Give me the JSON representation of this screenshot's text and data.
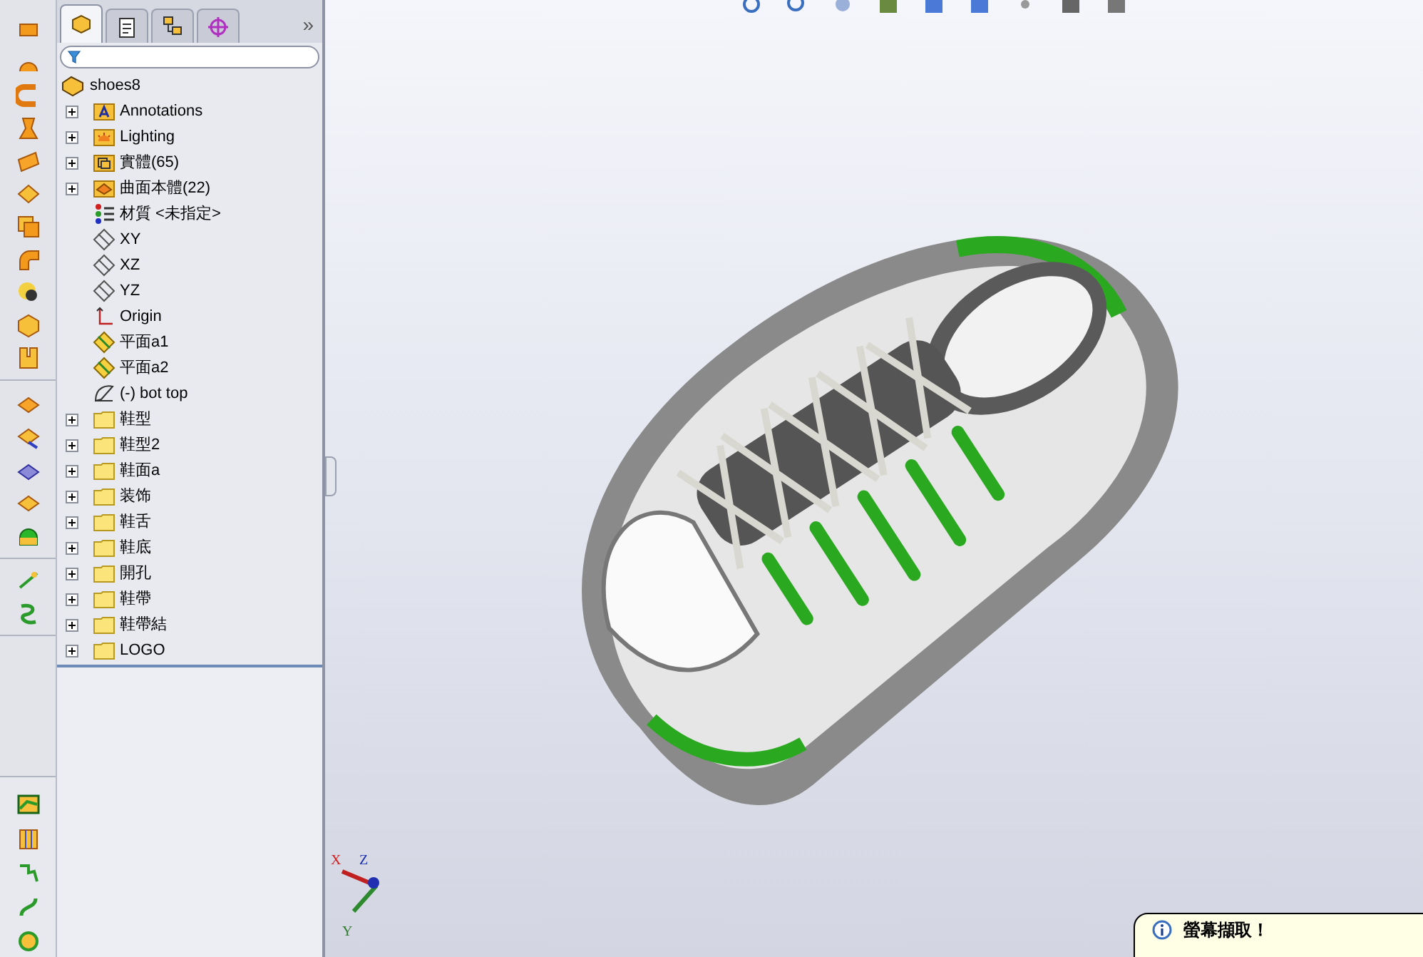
{
  "feature_tabs": [
    {
      "kind": "features",
      "selected": true
    },
    {
      "kind": "properties",
      "selected": false
    },
    {
      "kind": "configurations",
      "selected": false
    },
    {
      "kind": "dimxpert",
      "selected": false
    }
  ],
  "more_tabs": "»",
  "tree": {
    "root": {
      "label": "shoes8"
    },
    "items": [
      {
        "label": "Annotations",
        "kind": "annotations",
        "expanded": false
      },
      {
        "label": "Lighting",
        "kind": "lighting",
        "expanded": false
      },
      {
        "label": "實體(65)",
        "kind": "solids",
        "expanded": false
      },
      {
        "label": "曲面本體(22)",
        "kind": "surfaces",
        "expanded": false
      },
      {
        "label": "材質 <未指定>",
        "kind": "material"
      },
      {
        "label": "XY",
        "kind": "plane"
      },
      {
        "label": "XZ",
        "kind": "plane"
      },
      {
        "label": "YZ",
        "kind": "plane"
      },
      {
        "label": "Origin",
        "kind": "origin"
      },
      {
        "label": "平面a1",
        "kind": "refplane"
      },
      {
        "label": "平面a2",
        "kind": "refplane"
      },
      {
        "label": "(-) bot top",
        "kind": "sketch"
      },
      {
        "label": "鞋型",
        "kind": "folder",
        "expanded": false
      },
      {
        "label": "鞋型2",
        "kind": "folder",
        "expanded": false
      },
      {
        "label": "鞋面a",
        "kind": "folder",
        "expanded": false
      },
      {
        "label": "装饰",
        "kind": "folder",
        "expanded": false
      },
      {
        "label": "鞋舌",
        "kind": "folder",
        "expanded": false
      },
      {
        "label": "鞋底",
        "kind": "folder",
        "expanded": false
      },
      {
        "label": "開孔",
        "kind": "folder",
        "expanded": false
      },
      {
        "label": "鞋帶",
        "kind": "folder",
        "expanded": false
      },
      {
        "label": "鞋帶結",
        "kind": "folder",
        "expanded": false
      },
      {
        "label": "LOGO",
        "kind": "folder",
        "expanded": false
      }
    ]
  },
  "triad": {
    "x": "X",
    "y": "Y",
    "z": "Z"
  },
  "notification": {
    "title": "螢幕擷取！"
  }
}
